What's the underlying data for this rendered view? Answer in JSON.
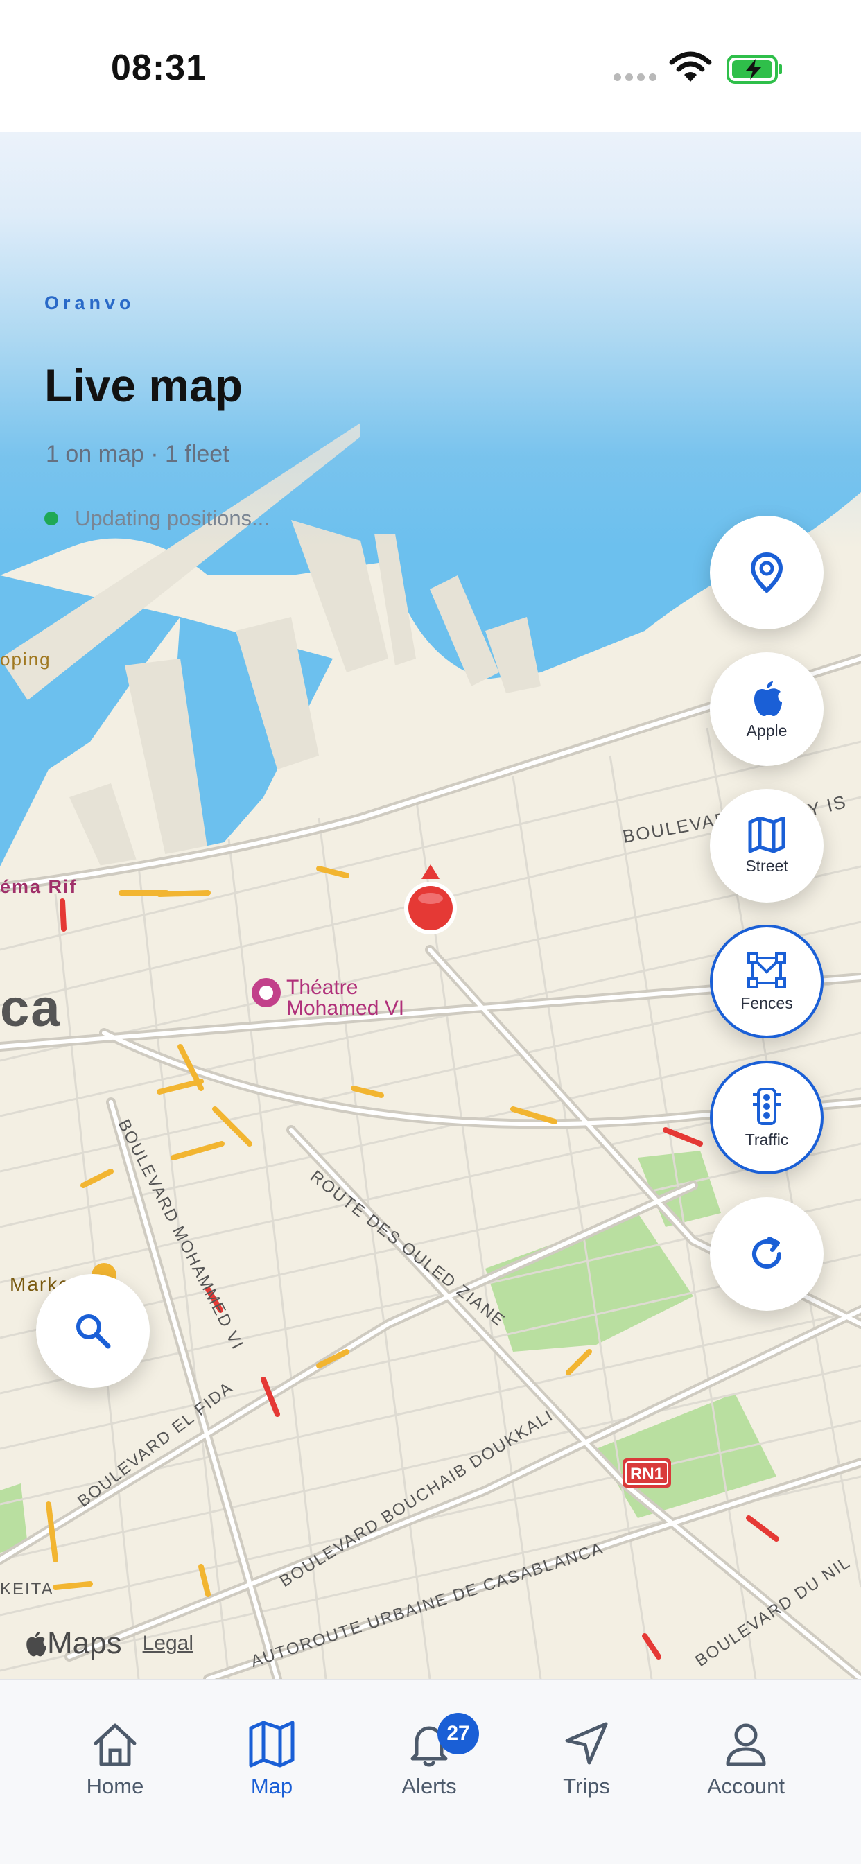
{
  "status_bar": {
    "time": "08:31"
  },
  "header": {
    "brand": "Oranvo",
    "title": "Live map",
    "summary": "1 on map · 1 fleet",
    "update_status": "Updating positions..."
  },
  "map": {
    "labels": {
      "boulevard_top": "BOULEVARD",
      "sea_edge": "Y IS",
      "poi_left": "oping",
      "cinema": "éma Rif",
      "city_partial": "ca",
      "theatre_line1": "Théatre",
      "theatre_line2": "Mohamed VI",
      "market": "Marke",
      "blvd_mohammed": "BOULEVARD MOHAMMED VI",
      "route_ouled": "ROUTE DES OULED ZIANE",
      "blvd_fida": "BOULEVARD EL FIDA",
      "blvd_doukkali": "BOULEVARD BOUCHAIB DOUKKALI",
      "autoroute": "AUTOROUTE URBAINE DE CASABLANCA",
      "blvd_du_nil": "BOULEVARD DU NIL",
      "keita": "KEITA",
      "rn1": "RN1"
    },
    "attribution": {
      "maps": "Maps",
      "legal": "Legal"
    }
  },
  "controls": {
    "locate_icon": "map-pin-icon",
    "apple": "Apple",
    "street": "Street",
    "fences": "Fences",
    "traffic": "Traffic",
    "refresh_icon": "refresh-icon",
    "search_icon": "search-icon"
  },
  "tabs": [
    {
      "label": "Home",
      "icon": "home-icon"
    },
    {
      "label": "Map",
      "icon": "map-icon"
    },
    {
      "label": "Alerts",
      "icon": "bell-icon",
      "badge": "27"
    },
    {
      "label": "Trips",
      "icon": "navigation-arrow-icon"
    },
    {
      "label": "Account",
      "icon": "user-icon"
    }
  ],
  "colors": {
    "accent": "#1a5fd6",
    "vehicle_marker": "#e53935",
    "online_dot": "#1fa855",
    "water": "#6cc0ee",
    "land": "#f3efe3",
    "park": "#a8d88a"
  }
}
